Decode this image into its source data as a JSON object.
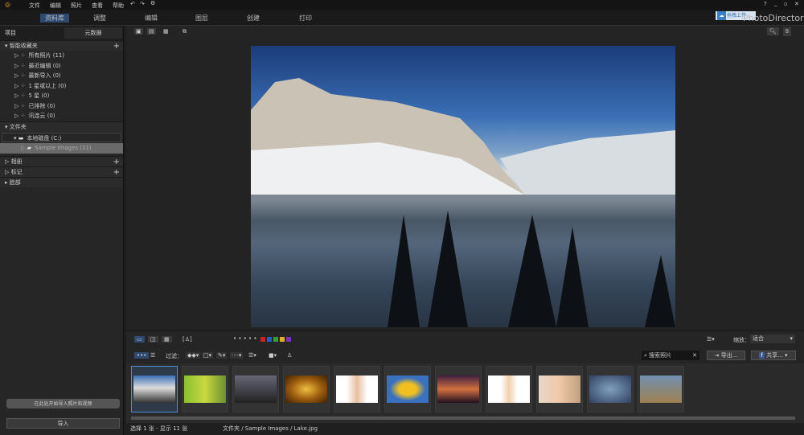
{
  "menu": [
    "文件",
    "编辑",
    "照片",
    "查看",
    "帮助"
  ],
  "tabs": [
    "资料库",
    "调整",
    "编辑",
    "图层",
    "创建",
    "打印"
  ],
  "app_title": "PhotoDirector",
  "upload_label": "拖拽上传",
  "left_tabs": [
    "项目",
    "元数据"
  ],
  "smart": {
    "title": "智能收藏夹",
    "items": [
      {
        "icon": "photos-icon",
        "label": "所有照片 (11)"
      },
      {
        "icon": "recent-edit-icon",
        "label": "最近编辑 (0)"
      },
      {
        "icon": "import-icon",
        "label": "最新导入 (0)"
      },
      {
        "icon": "star-icon",
        "label": "1 星或以上 (0)"
      },
      {
        "icon": "star-icon",
        "label": "5 星 (0)"
      },
      {
        "icon": "reject-icon",
        "label": "已排除 (0)"
      },
      {
        "icon": "cloud-icon",
        "label": "讯连云 (0)"
      }
    ]
  },
  "folders": {
    "title": "文件夹",
    "drive": "本地磁盘 (C:)",
    "folder": "Sample Images (11)"
  },
  "albums": "相册",
  "tags": "标记",
  "faces": "脸部",
  "import_hint": "在此处开始导入照片和视频",
  "import_btn": "导入",
  "filter_label": "过滤：",
  "zoom_label": "缩放：",
  "zoom_value": "适合",
  "search_placeholder": "搜索照片",
  "export": "导出...",
  "share": "共享...",
  "color_labels": [
    "#d42020",
    "#2060d0",
    "#30a030",
    "#e0b020",
    "#8030c0"
  ],
  "status": {
    "selection": "选择 1 张 - 显示 11 张",
    "path": "文件夹 / Sample Images / Lake.jpg"
  },
  "thumbs": [
    {
      "name": "lake",
      "grad": "linear-gradient(#3a6fb5,#ddd 45%,#333)"
    },
    {
      "name": "leaves",
      "grad": "linear-gradient(90deg,#8ac030,#c8d840,#6a9030)"
    },
    {
      "name": "dark-landscape",
      "grad": "linear-gradient(#667,#222)"
    },
    {
      "name": "spiral",
      "grad": "radial-gradient(#f0c040,#a06010,#402000)"
    },
    {
      "name": "portrait-woman",
      "grad": "linear-gradient(90deg,#fff 25%,#e8c0a0 50%,#fff 75%)"
    },
    {
      "name": "sunflower",
      "grad": "radial-gradient(#f0c020 30%,#3a70c0 60%)"
    },
    {
      "name": "sunset",
      "grad": "linear-gradient(#402040,#d07040,#201020)"
    },
    {
      "name": "blonde-woman",
      "grad": "linear-gradient(90deg,#fff 30%,#f0d0b0 50%,#fff 70%)"
    },
    {
      "name": "smiling-woman",
      "grad": "linear-gradient(90deg,#e8d8c8,#f0c8a8,#c0a080)"
    },
    {
      "name": "panorama-city",
      "grad": "radial-gradient(#80a0c0,#304060)"
    },
    {
      "name": "panorama-field",
      "grad": "linear-gradient(#7090b0,#a08050)"
    }
  ]
}
